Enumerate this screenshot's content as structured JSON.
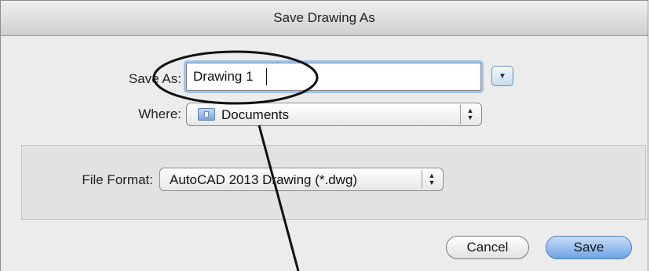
{
  "dialog": {
    "title": "Save Drawing As"
  },
  "save_as": {
    "label": "Save As:",
    "value": "Drawing 1"
  },
  "where": {
    "label": "Where:",
    "selected": "Documents"
  },
  "file_format": {
    "label": "File Format:",
    "selected": "AutoCAD 2013 Drawing (*.dwg)"
  },
  "buttons": {
    "cancel": "Cancel",
    "save": "Save"
  },
  "icons": {
    "expand": "disclosure-triangle-icon",
    "folder": "documents-folder-icon",
    "stepper": "up-down-arrows-icon"
  },
  "colors": {
    "focus_ring": "#9ec3ee",
    "default_button": "#6ea4e6"
  }
}
